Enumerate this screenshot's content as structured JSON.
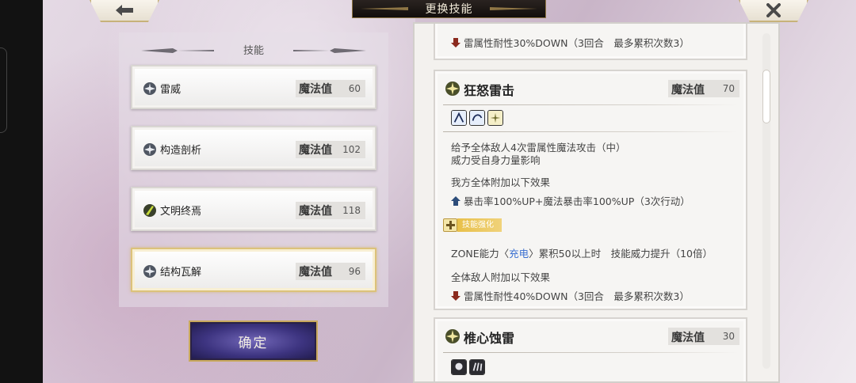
{
  "header": {
    "title": "更换技能",
    "back_icon": "arrow-left-icon",
    "close_icon": "close-x-icon"
  },
  "skill_list": {
    "heading": "技能",
    "items": [
      {
        "name": "雷威",
        "mp_label": "魔法值",
        "mp_value": "60",
        "icon": "thunder-gear-icon",
        "selected": false
      },
      {
        "name": "构造剖析",
        "mp_label": "魔法值",
        "mp_value": "102",
        "icon": "thunder-gear-icon",
        "selected": false
      },
      {
        "name": "文明终焉",
        "mp_label": "魔法值",
        "mp_value": "118",
        "icon": "green-slash-icon",
        "selected": false
      },
      {
        "name": "结构瓦解",
        "mp_label": "魔法值",
        "mp_value": "96",
        "icon": "thunder-gear-icon",
        "selected": true
      }
    ]
  },
  "confirm_button": {
    "label": "确定"
  },
  "details": {
    "card0": {
      "debuff_line": "雷属性耐性30%DOWN（3回合　最多累积次数3）"
    },
    "card1": {
      "name": "狂怒雷击",
      "mp_label": "魔法值",
      "mp_value": "70",
      "desc_line1": "给予全体敌人4次雷属性魔法攻击（中）",
      "desc_line2": "威力受自身力量影响",
      "ally_heading": "我方全体附加以下效果",
      "buff_line": "暴击率100%UP+魔法暴击率100%UP（3次行动）",
      "enhance_label": "技能强化",
      "zone_prefix": "ZONE能力〈",
      "zone_highlight": "充电",
      "zone_suffix": "〉累积50以上时　技能威力提升（10倍）",
      "enemy_heading": "全体敌人附加以下效果",
      "debuff_line": "雷属性耐性40%DOWN（3回合　最多累积次数3）"
    },
    "card2": {
      "name": "椎心蚀雷",
      "mp_label": "魔法值",
      "mp_value": "30"
    }
  },
  "colors": {
    "accent_gold": "#c9a95d",
    "confirm_purple": "#3d3480",
    "debuff_red": "#8b2a1e",
    "buff_blue": "#2d4d7a",
    "link_blue": "#3a6fd1"
  }
}
